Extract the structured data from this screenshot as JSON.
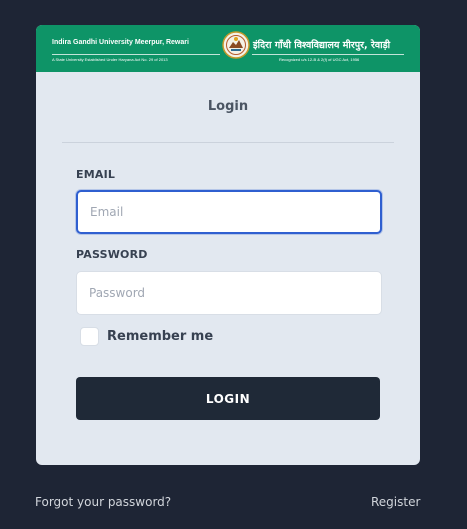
{
  "banner": {
    "name_en": "Indira Gandhi University Meerpur, Rewari",
    "name_hi": "इंदिरा गाँधी विश्वविद्यालय मीरपुर, रेवाड़ी",
    "sub_en": "A State University Established Under Haryana Act No. 29 of 2013",
    "sub_hi": "Recognized u/s 12-B & 2(f) of UGC Act, 1956",
    "emblem_icon": "university-emblem-icon",
    "color": "#0e9467"
  },
  "login": {
    "title": "Login",
    "email_label": "EMAIL",
    "email_placeholder": "Email",
    "email_value": "",
    "password_label": "PASSWORD",
    "password_placeholder": "Password",
    "password_value": "",
    "remember_label": "Remember me",
    "remember_checked": false,
    "button_label": "LOGIN"
  },
  "footer": {
    "forgot_label": "Forgot your password?",
    "register_label": "Register"
  },
  "colors": {
    "background": "#1e2535",
    "card": "#e2e8f0",
    "button": "#1f2937",
    "focus_ring": "#2f5fd0"
  }
}
